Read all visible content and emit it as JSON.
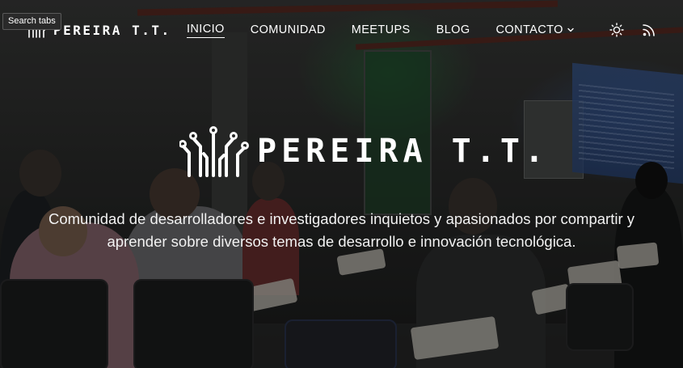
{
  "tooltip": {
    "text": "Search tabs"
  },
  "brand": {
    "name": "PEREIRA T.T.",
    "logo_icon": "circuit-hand-icon"
  },
  "nav": {
    "items": [
      {
        "label": "INICIO",
        "active": true
      },
      {
        "label": "COMUNIDAD",
        "active": false
      },
      {
        "label": "MEETUPS",
        "active": false
      },
      {
        "label": "BLOG",
        "active": false
      },
      {
        "label": "CONTACTO",
        "active": false,
        "has_dropdown": true
      }
    ],
    "icons": [
      "sun-icon",
      "rss-icon"
    ]
  },
  "hero": {
    "title": "PEREIRA T.T.",
    "description": "Comunidad de desarrolladores e investigadores inquietos y apasionados por compartir y aprender sobre diversos temas de desarrollo e innovación tecnológica."
  },
  "colors": {
    "text": "#ffffff",
    "overlay": "rgba(0,0,0,0.38)"
  }
}
